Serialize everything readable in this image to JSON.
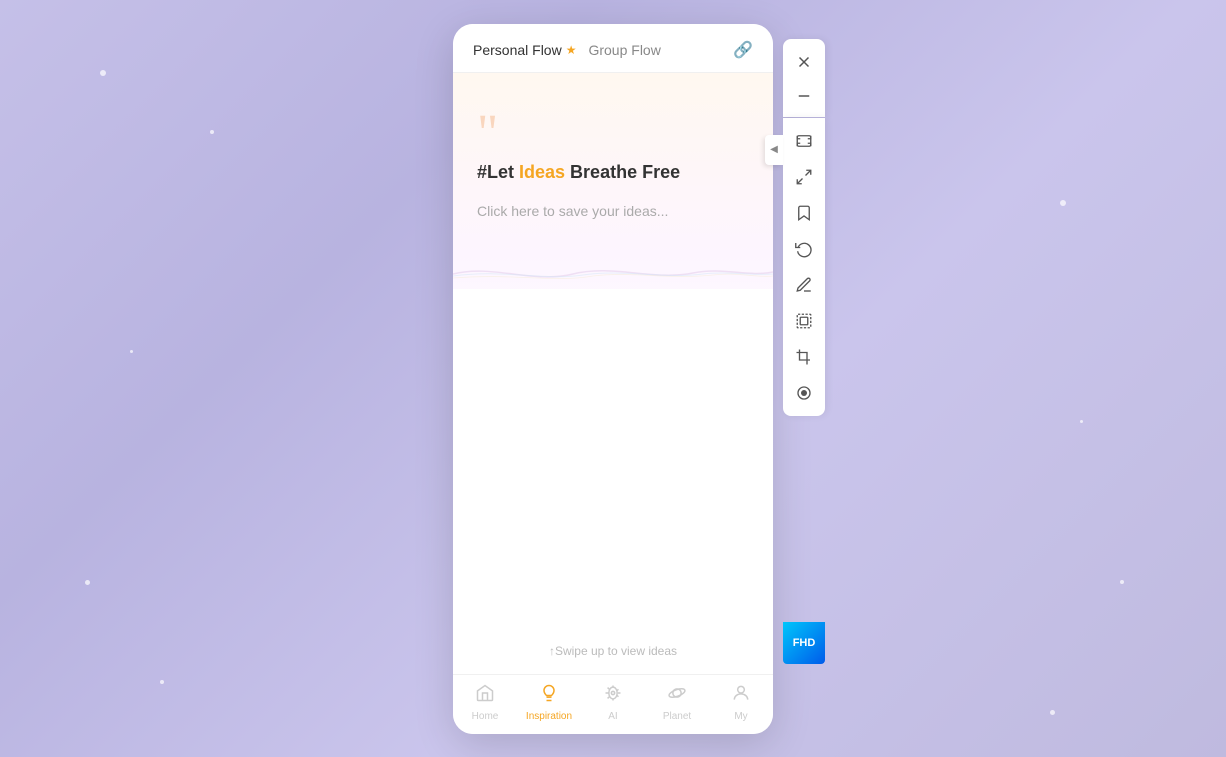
{
  "background": {
    "color": "#c5c0e8"
  },
  "tabs": {
    "personal": {
      "label": "Personal Flow",
      "active": true,
      "star": "★"
    },
    "group": {
      "label": "Group Flow",
      "active": false
    }
  },
  "link_icon": "🔗",
  "content": {
    "quote_marks": "❝",
    "headline_prefix": "#Let ",
    "headline_highlight": "Ideas",
    "headline_suffix": " Breathe Free",
    "save_prompt": "Click here to save your ideas...",
    "swipe_hint": "↑Swipe up to view ideas"
  },
  "bottom_nav": [
    {
      "id": "home",
      "label": "Home",
      "icon": "home",
      "active": false
    },
    {
      "id": "inspiration",
      "label": "Inspiration",
      "icon": "bulb",
      "active": true
    },
    {
      "id": "ai",
      "label": "AI",
      "icon": "alien",
      "active": false
    },
    {
      "id": "planet",
      "label": "Planet",
      "icon": "planet",
      "active": false
    },
    {
      "id": "my",
      "label": "My",
      "icon": "person",
      "active": false
    }
  ],
  "toolbar": {
    "close_label": "✕",
    "minimize_label": "—",
    "buttons": [
      {
        "id": "screenshot",
        "icon": "screenshot"
      },
      {
        "id": "expand",
        "icon": "expand"
      },
      {
        "id": "bookmark",
        "icon": "bookmark"
      },
      {
        "id": "undo",
        "icon": "undo"
      },
      {
        "id": "edit",
        "icon": "edit"
      },
      {
        "id": "frame",
        "icon": "frame"
      },
      {
        "id": "crop",
        "icon": "crop"
      },
      {
        "id": "record",
        "icon": "record"
      }
    ],
    "collapse_label": "◀",
    "fhd_label": "FHD"
  }
}
